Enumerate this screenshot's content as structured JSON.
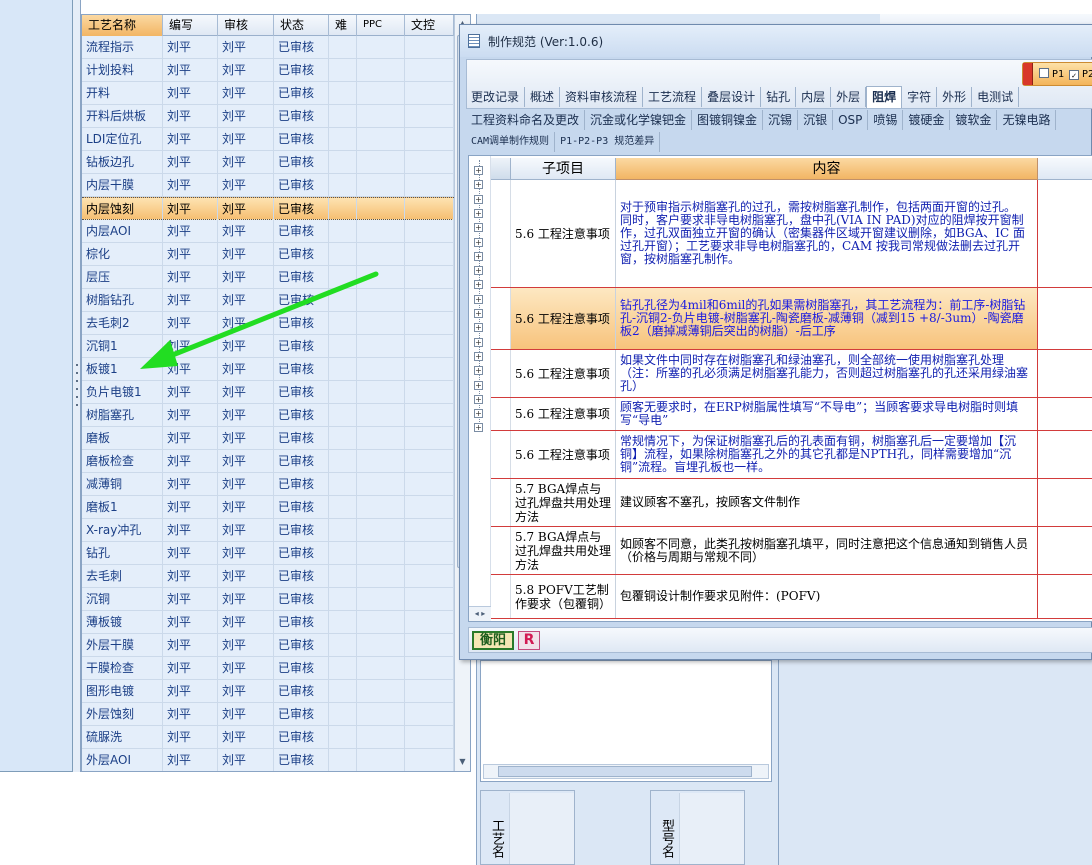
{
  "grid": {
    "columns": [
      "工艺名称",
      "编写",
      "审核",
      "状态",
      "难",
      "PPC",
      "文控"
    ],
    "selected_row": 7,
    "rows": [
      [
        "流程指示",
        "刘平",
        "刘平",
        "已审核"
      ],
      [
        "计划投料",
        "刘平",
        "刘平",
        "已审核"
      ],
      [
        "开料",
        "刘平",
        "刘平",
        "已审核"
      ],
      [
        "开料后烘板",
        "刘平",
        "刘平",
        "已审核"
      ],
      [
        "LDI定位孔",
        "刘平",
        "刘平",
        "已审核"
      ],
      [
        "钻板边孔",
        "刘平",
        "刘平",
        "已审核"
      ],
      [
        "内层干膜",
        "刘平",
        "刘平",
        "已审核"
      ],
      [
        "内层蚀刻",
        "刘平",
        "刘平",
        "已审核"
      ],
      [
        "内层AOI",
        "刘平",
        "刘平",
        "已审核"
      ],
      [
        "棕化",
        "刘平",
        "刘平",
        "已审核"
      ],
      [
        "层压",
        "刘平",
        "刘平",
        "已审核"
      ],
      [
        "树脂钻孔",
        "刘平",
        "刘平",
        "已审核"
      ],
      [
        "去毛刺2",
        "刘平",
        "刘平",
        "已审核"
      ],
      [
        "沉铜1",
        "刘平",
        "刘平",
        "已审核"
      ],
      [
        "板镀1",
        "刘平",
        "刘平",
        "已审核"
      ],
      [
        "负片电镀1",
        "刘平",
        "刘平",
        "已审核"
      ],
      [
        "树脂塞孔",
        "刘平",
        "刘平",
        "已审核"
      ],
      [
        "磨板",
        "刘平",
        "刘平",
        "已审核"
      ],
      [
        "磨板检查",
        "刘平",
        "刘平",
        "已审核"
      ],
      [
        "减薄铜",
        "刘平",
        "刘平",
        "已审核"
      ],
      [
        "磨板1",
        "刘平",
        "刘平",
        "已审核"
      ],
      [
        "X-ray冲孔",
        "刘平",
        "刘平",
        "已审核"
      ],
      [
        "钻孔",
        "刘平",
        "刘平",
        "已审核"
      ],
      [
        "去毛刺",
        "刘平",
        "刘平",
        "已审核"
      ],
      [
        "沉铜",
        "刘平",
        "刘平",
        "已审核"
      ],
      [
        "薄板镀",
        "刘平",
        "刘平",
        "已审核"
      ],
      [
        "外层干膜",
        "刘平",
        "刘平",
        "已审核"
      ],
      [
        "干膜检查",
        "刘平",
        "刘平",
        "已审核"
      ],
      [
        "图形电镀",
        "刘平",
        "刘平",
        "已审核"
      ],
      [
        "外层蚀刻",
        "刘平",
        "刘平",
        "已审核"
      ],
      [
        "硫脲洗",
        "刘平",
        "刘平",
        "已审核"
      ],
      [
        "外层AOI",
        "刘平",
        "刘平",
        "已审核"
      ]
    ]
  },
  "dialog": {
    "title": "制作规范 (Ver:1.0.6)",
    "p_selector": {
      "p1": "P1",
      "p2": "P2",
      "p1_checked": false,
      "p2_checked": true
    },
    "tabs_row1": [
      "更改记录",
      "概述",
      "资料审核流程",
      "工艺流程",
      "叠层设计",
      "钻孔",
      "内层",
      "外层",
      "阻焊",
      "字符",
      "外形",
      "电测试"
    ],
    "active_tab": "阻焊",
    "tabs_row2": [
      "工程资料命名及更改",
      "沉金或化学镍钯金",
      "图镀铜镍金",
      "沉锡",
      "沉银",
      "OSP",
      "喷锡",
      "镀硬金",
      "镀软金",
      "无镍电路"
    ],
    "tabs_row3": [
      "CAM调单制作规则",
      "P1-P2-P3 规范差异"
    ],
    "headers": {
      "sub": "子项目",
      "content": "内容"
    },
    "rows": [
      {
        "sub": "5.6 工程注意事项",
        "content": "对于预审指示树脂塞孔的过孔，需按树脂塞孔制作，包括两面开窗的过孔。\n同时，客户要求非导电树脂塞孔，盘中孔(VIA IN PAD)对应的阻焊按开窗制作，过孔双面独立开窗的确认（密集器件区域开窗建议删除，如BGA、IC 面过孔开窗）；工艺要求非导电树脂塞孔的，CAM 按我司常规做法删去过孔开窗，按树脂塞孔制作。",
        "style": "blue"
      },
      {
        "sub": "5.6 工程注意事项",
        "content": "钻孔孔径为4mil和6mil的孔如果需树脂塞孔，其工艺流程为：前工序-树脂钻孔-沉铜2-负片电镀-树脂塞孔-陶瓷磨板-减薄铜（减到15 +8/-3um）-陶瓷磨板2（磨掉减薄铜后突出的树脂）-后工序",
        "style": "hl"
      },
      {
        "sub": "5.6 工程注意事项",
        "content": "如果文件中同时存在树脂塞孔和绿油塞孔，则全部统一使用树脂塞孔处理（注：所塞的孔必须满足树脂塞孔能力，否则超过树脂塞孔的孔还采用绿油塞孔）",
        "style": "blue"
      },
      {
        "sub": "5.6 工程注意事项",
        "content": "顾客无要求时，在ERP树脂属性填写“不导电”；当顾客要求导电树脂时则填写“导电”",
        "style": "blue"
      },
      {
        "sub": "5.6 工程注意事项",
        "content": "常规情况下，为保证树脂塞孔后的孔表面有铜，树脂塞孔后一定要增加【沉铜】流程，如果除树脂塞孔之外的其它孔都是NPTH孔，同样需要增加“沉铜”流程。盲埋孔板也一样。",
        "style": "blue"
      },
      {
        "sub": "5.7 BGA焊点与过孔焊盘共用处理方法",
        "content": "建议顾客不塞孔，按顾客文件制作",
        "style": "black"
      },
      {
        "sub": "5.7 BGA焊点与过孔焊盘共用处理方法",
        "content": "如顾客不同意，此类孔按树脂塞孔填平，同时注意把这个信息通知到销售人员（价格与周期与常规不同）",
        "style": "black"
      },
      {
        "sub": "5.8 POFV工艺制作要求（包覆铜）",
        "content": "包覆铜设计制作要求见附件：(POFV)",
        "style": "black"
      }
    ],
    "status_logo_a": "衡阳",
    "status_logo_b": "R"
  },
  "background": {
    "label_a": "工艺名",
    "label_b": "型号名"
  },
  "annotation": {
    "arrow_color": "#22dd22"
  },
  "colors": {
    "selection": "#f6bf72",
    "header_blue": "#dfe8f4",
    "row_border": "#d23b3b"
  }
}
